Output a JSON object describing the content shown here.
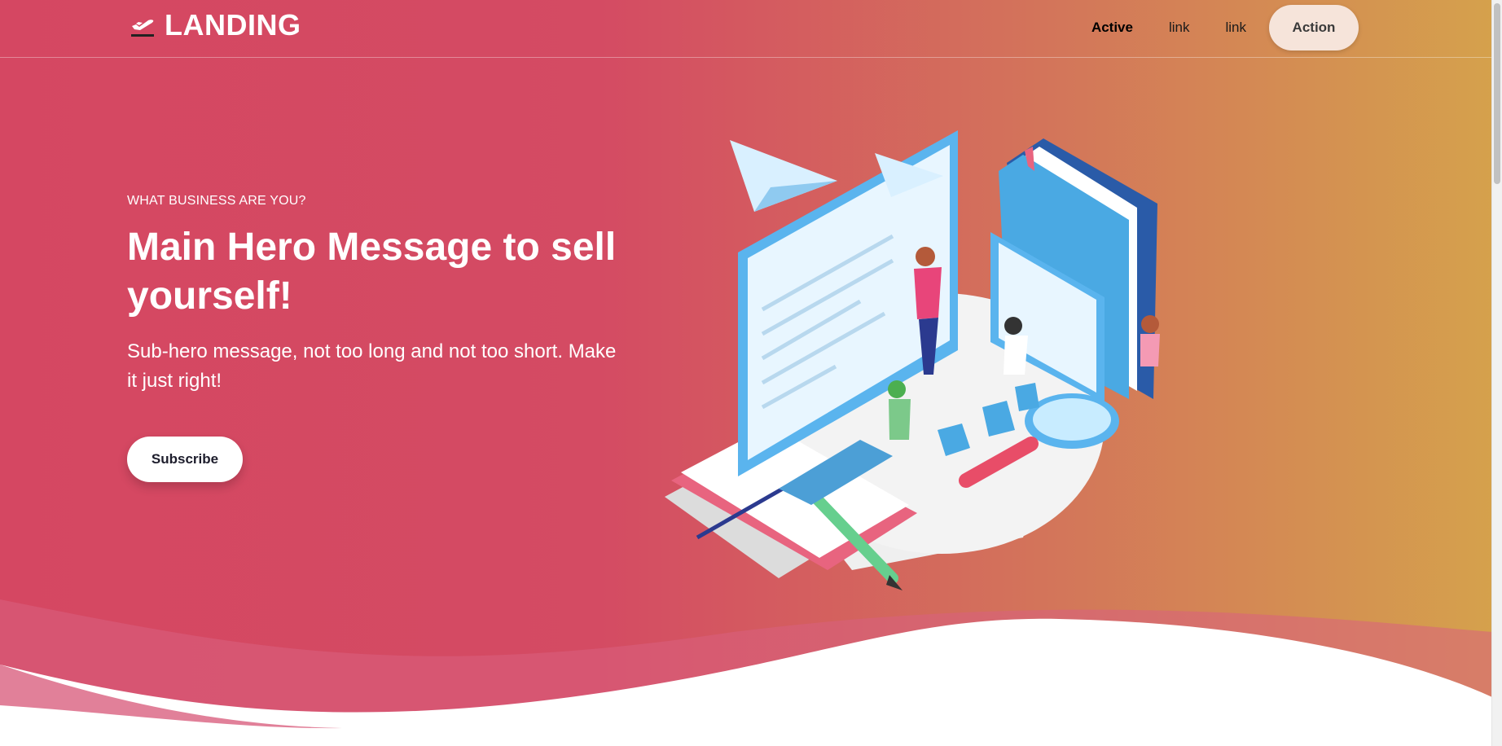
{
  "brand": {
    "name": "LANDING",
    "icon": "plane-departure-icon"
  },
  "nav": {
    "items": [
      {
        "label": "Active",
        "active": true
      },
      {
        "label": "link",
        "active": false
      },
      {
        "label": "link",
        "active": false
      }
    ],
    "action_label": "Action"
  },
  "hero": {
    "eyebrow": "WHAT BUSINESS ARE YOU?",
    "title": "Main Hero Message to sell yourself!",
    "subtitle": "Sub-hero message, not too long and not too short. Make it just right!",
    "cta_label": "Subscribe"
  },
  "colors": {
    "gradient_start": "#d54762",
    "gradient_end": "#d5a24c",
    "action_bg": "#f6e4da",
    "white": "#ffffff"
  }
}
